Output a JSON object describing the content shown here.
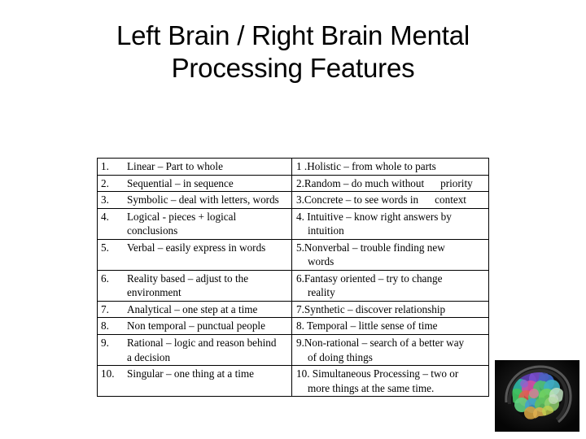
{
  "slide": {
    "title": "Left Brain / Right Brain Mental Processing Features",
    "title_line1": "Left Brain / Right Brain Mental",
    "title_line2": "Processing Features"
  },
  "table": {
    "rows": [
      {
        "left_num": "1.",
        "left_text": "Linear – Part to whole",
        "left_cont": "",
        "right_text": "1 .Holistic – from whole to parts",
        "right_cont": ""
      },
      {
        "left_num": "2.",
        "left_text": "Sequential – in sequence",
        "left_cont": "",
        "right_text": "2.Random – do much without",
        "right_text_tail": "priority",
        "right_cont": ""
      },
      {
        "left_num": "3.",
        "left_text": "Symbolic – deal with letters, words",
        "left_cont": "",
        "right_text": "3.Concrete – to see words in",
        "right_text_tail": "context",
        "right_cont": ""
      },
      {
        "left_num": "4.",
        "left_text": "Logical -  pieces + logical",
        "left_cont": "conclusions",
        "right_text": "4. Intuitive – know right answers  by",
        "right_cont": "intuition"
      },
      {
        "left_num": "5.",
        "left_text": "Verbal – easily express in words",
        "left_cont": "",
        "right_text": "5.Nonverbal – trouble finding new",
        "right_cont": "words"
      },
      {
        "left_num": "6.",
        "left_text": "Reality based – adjust to the",
        "left_cont": "environment",
        "right_text": "6.Fantasy oriented – try to change",
        "right_cont": "reality"
      },
      {
        "left_num": "7.",
        "left_text": "Analytical – one step at a time",
        "left_cont": "",
        "right_text": "7.Synthetic – discover relationship",
        "right_cont": ""
      },
      {
        "left_num": "8.",
        "left_text": "Non temporal – punctual people",
        "left_cont": "",
        "right_text": "8. Temporal – little sense of time",
        "right_cont": ""
      },
      {
        "left_num": "9.",
        "left_text": "Rational – logic and reason behind",
        "left_cont": "a decision",
        "right_text": "9.Non-rational – search of a better way",
        "right_cont": "of doing things"
      },
      {
        "left_num": "10.",
        "left_text": "Singular – one thing at a time",
        "left_cont": "",
        "right_text": "10. Simultaneous Processing – two or",
        "right_cont": "more things at the same time."
      }
    ]
  },
  "figure": {
    "name": "brain-scan-image",
    "description": "Colorful DTI brain scan",
    "background_color": "#050505"
  }
}
